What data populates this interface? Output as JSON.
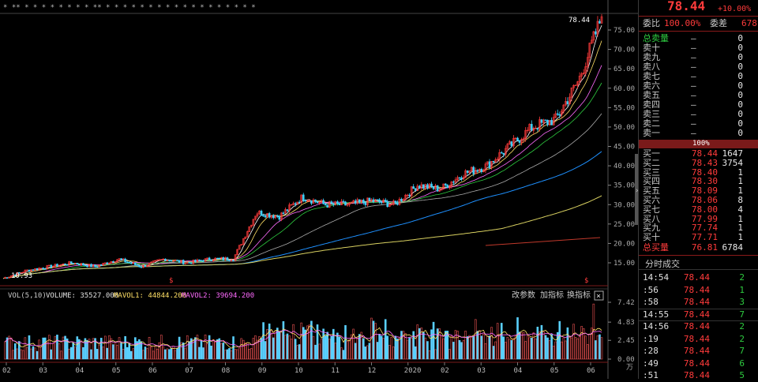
{
  "header": {
    "price": "78.44",
    "change_pct": "+10.00%",
    "committee_ratio_label": "委比",
    "committee_ratio_value": "100.00%",
    "committee_diff_label": "委差",
    "committee_diff_value": "678"
  },
  "top_strip": {
    "marks": "* ** * * *  * * * *  * ** * * *  * *  * *  * *  * *  * *  * *  * * *"
  },
  "price_axis": {
    "ticks": [
      "75.00",
      "70.00",
      "65.00",
      "60.00",
      "55.00",
      "50.00",
      "45.00",
      "40.00",
      "35.00",
      "30.00",
      "25.00",
      "20.00",
      "15.00"
    ],
    "last_price_label": "78.44",
    "low_label": "10.93"
  },
  "volume_panel": {
    "title": "VOL(5,10)",
    "vol_label": "VOLUME: 35527.000",
    "mavol1_label": "MAVOL1: 44844.200",
    "mavol2_label": "MAVOL2: 39694.200",
    "toolbar_change_params": "改参数",
    "toolbar_add_indicator": "加指标",
    "toolbar_swap_indicator": "换指标",
    "close_symbol": "×",
    "ticks": [
      "7.42",
      "4.83",
      "2.45",
      "0.00"
    ],
    "unit": "万",
    "colors": {
      "mavol1": "#ffe066",
      "mavol2": "#ff6bff",
      "up": "#e65050",
      "down": "#5ad0ff"
    }
  },
  "time_axis": {
    "labels": [
      "02",
      "03",
      "04",
      "05",
      "06",
      "07",
      "08",
      "09",
      "10",
      "11",
      "12",
      "2020",
      "02",
      "03",
      "04",
      "05",
      "06"
    ]
  },
  "order_book": {
    "total_sell_label": "总卖量",
    "total_sell_value": "0",
    "sells": [
      {
        "label": "卖十",
        "price": "—",
        "qty": "0"
      },
      {
        "label": "卖九",
        "price": "—",
        "qty": "0"
      },
      {
        "label": "卖八",
        "price": "—",
        "qty": "0"
      },
      {
        "label": "卖七",
        "price": "—",
        "qty": "0"
      },
      {
        "label": "卖六",
        "price": "—",
        "qty": "0"
      },
      {
        "label": "卖五",
        "price": "—",
        "qty": "0"
      },
      {
        "label": "卖四",
        "price": "—",
        "qty": "0"
      },
      {
        "label": "卖三",
        "price": "—",
        "qty": "0"
      },
      {
        "label": "卖二",
        "price": "—",
        "qty": "0"
      },
      {
        "label": "卖一",
        "price": "—",
        "qty": "0"
      }
    ],
    "bar_pct": "100%",
    "buys": [
      {
        "label": "买一",
        "price": "78.44",
        "qty": "1647"
      },
      {
        "label": "买二",
        "price": "78.43",
        "qty": "3754"
      },
      {
        "label": "买三",
        "price": "78.40",
        "qty": "1"
      },
      {
        "label": "买四",
        "price": "78.30",
        "qty": "1"
      },
      {
        "label": "买五",
        "price": "78.09",
        "qty": "1"
      },
      {
        "label": "买六",
        "price": "78.06",
        "qty": "8"
      },
      {
        "label": "买七",
        "price": "78.00",
        "qty": "4"
      },
      {
        "label": "买八",
        "price": "77.99",
        "qty": "1"
      },
      {
        "label": "买九",
        "price": "77.74",
        "qty": "1"
      },
      {
        "label": "买十",
        "price": "77.71",
        "qty": "1"
      }
    ],
    "total_buy_label": "总买量",
    "total_buy_price": "76.81",
    "total_buy_value": "6784"
  },
  "trades": {
    "title": "分时成交",
    "rows": [
      {
        "time": "14:54",
        "price": "78.44",
        "vol": "2"
      },
      {
        "time": ":56",
        "price": "78.44",
        "vol": "1"
      },
      {
        "time": ":58",
        "price": "78.44",
        "vol": "3"
      },
      {
        "time": "14:55",
        "price": "78.44",
        "vol": "7"
      },
      {
        "time": "14:56",
        "price": "78.44",
        "vol": "2"
      },
      {
        "time": ":19",
        "price": "78.44",
        "vol": "2"
      },
      {
        "time": ":28",
        "price": "78.44",
        "vol": "7"
      },
      {
        "time": ":49",
        "price": "78.44",
        "vol": "6"
      },
      {
        "time": ":51",
        "price": "78.44",
        "vol": "5"
      }
    ]
  },
  "chart_data": {
    "type": "line",
    "title": "",
    "xlabel": "",
    "ylabel": "",
    "ylim": [
      12,
      80
    ],
    "series": [
      {
        "values": [
          11,
          13,
          14,
          15,
          14,
          16,
          14,
          16,
          15,
          16,
          16,
          28,
          27,
          32,
          30,
          30,
          31,
          30,
          35,
          34,
          38,
          40,
          45,
          50,
          52,
          62,
          78.44
        ]
      }
    ]
  }
}
